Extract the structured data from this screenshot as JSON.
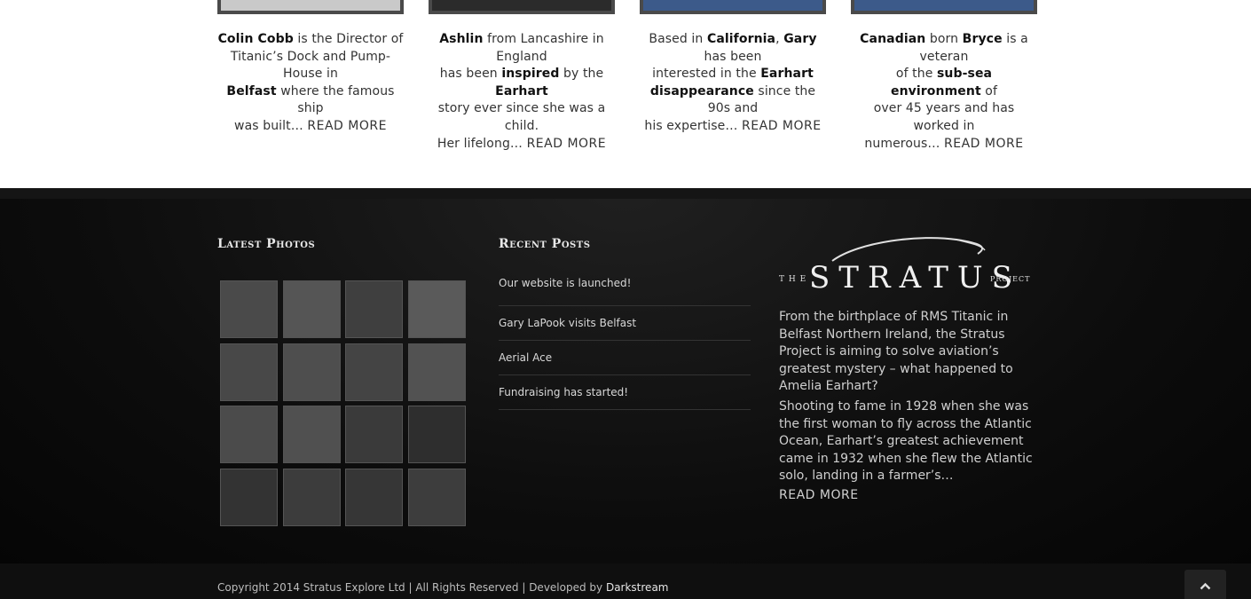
{
  "team": [
    {
      "lines": [
        [
          {
            "b": "Colin Cobb"
          },
          {
            "t": " is the Director of"
          }
        ],
        [
          {
            "t": "Titanic’s Dock and Pump-House in"
          }
        ],
        [
          {
            "b": "Belfast"
          },
          {
            "t": " where the famous ship"
          }
        ],
        [
          {
            "t": "was built… "
          },
          {
            "m": "READ MORE"
          }
        ]
      ]
    },
    {
      "lines": [
        [
          {
            "b": "Ashlin"
          },
          {
            "t": " from Lancashire in England"
          }
        ],
        [
          {
            "t": "has been "
          },
          {
            "b": "inspired"
          },
          {
            "t": " by the "
          },
          {
            "b": "Earhart"
          }
        ],
        [
          {
            "t": "story ever since she was a child."
          }
        ],
        [
          {
            "t": "Her lifelong… "
          },
          {
            "m": "READ MORE"
          }
        ]
      ]
    },
    {
      "lines": [
        [
          {
            "t": "Based in "
          },
          {
            "b": "California"
          },
          {
            "t": ", "
          },
          {
            "b": "Gary"
          },
          {
            "t": " has been"
          }
        ],
        [
          {
            "t": "interested in the "
          },
          {
            "b": "Earhart"
          }
        ],
        [
          {
            "b": "disappearance"
          },
          {
            "t": " since the 90s and"
          }
        ],
        [
          {
            "t": "his expertise… "
          },
          {
            "m": "READ MORE"
          }
        ]
      ]
    },
    {
      "lines": [
        [
          {
            "b": "Canadian"
          },
          {
            "t": " born "
          },
          {
            "b": "Bryce"
          },
          {
            "t": " is a veteran"
          }
        ],
        [
          {
            "t": "of the "
          },
          {
            "b": "sub-sea environment"
          },
          {
            "t": " of"
          }
        ],
        [
          {
            "t": "over 45 years and has worked in"
          }
        ],
        [
          {
            "t": "numerous… "
          },
          {
            "m": "READ MORE"
          }
        ]
      ]
    }
  ],
  "footer": {
    "latest_photos_title": "Latest Photos",
    "recent_posts_title": "Recent Posts",
    "posts": [
      "Our website is launched!",
      "Gary LaPook visits Belfast",
      "Aerial Ace",
      "Fundraising has started!"
    ],
    "logo_text": "THE STRATUS PROJECT",
    "about_p1": "From the birthplace of RMS Titanic in Belfast Northern Ireland, the Stratus Project is aiming to solve aviation’s greatest mystery – what happened to Amelia Earhart?",
    "about_p2": "Shooting to fame in 1928 when she was the first woman to fly across the Atlantic Ocean, Earhart’s greatest achievement came in 1932 when she flew the Atlantic solo, landing in a farmer’s…",
    "read_more": "READ MORE",
    "copyright": "Copyright 2014 Stratus Explore Ltd | All Rights Reserved | Developed by ",
    "developer": "Darkstream",
    "back_to_top_icon": "chevron-up-icon"
  }
}
